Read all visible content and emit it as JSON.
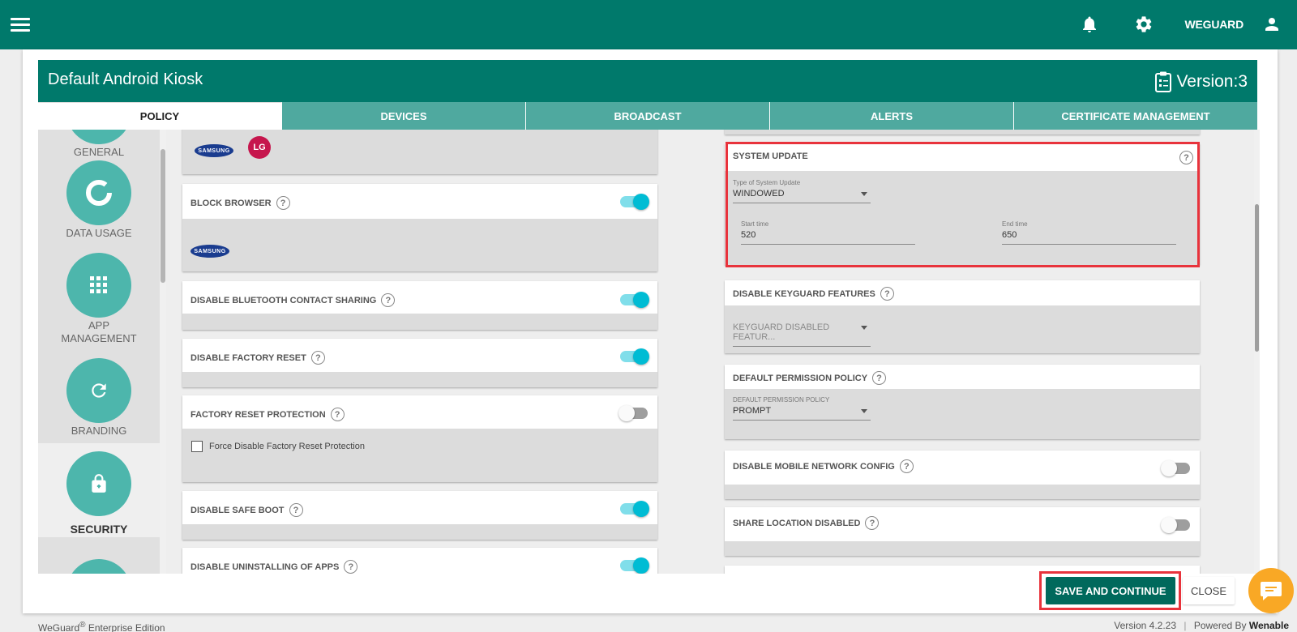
{
  "topbar": {
    "menu_icon": "hamburger-menu-icon",
    "user_name": "WEGUARD",
    "bg_color": "#00796b"
  },
  "policy": {
    "title": "Default Android Kiosk",
    "version": "Version:3"
  },
  "tabs": [
    {
      "label": "POLICY",
      "active": true
    },
    {
      "label": "DEVICES"
    },
    {
      "label": "BROADCAST"
    },
    {
      "label": "ALERTS"
    },
    {
      "label": "CERTIFICATE MANAGEMENT"
    }
  ],
  "sidebar": {
    "items": [
      {
        "label": "GENERAL",
        "icon": "general-icon"
      },
      {
        "label": "DATA USAGE",
        "icon": "donut-chart-icon"
      },
      {
        "label": "APP MANAGEMENT",
        "line1": "APP",
        "line2": "MANAGEMENT",
        "icon": "apps-grid-icon"
      },
      {
        "label": "BRANDING",
        "icon": "refresh-icon"
      },
      {
        "label": "SECURITY",
        "icon": "lock-icon",
        "active": true
      }
    ]
  },
  "left_panels": {
    "logos_panel": {
      "samsung": "SAMSUNG",
      "lg": "LG"
    },
    "block_browser": {
      "title": "BLOCK BROWSER",
      "enabled": true,
      "samsung": "SAMSUNG"
    },
    "bluetooth": {
      "title": "DISABLE BLUETOOTH CONTACT SHARING",
      "enabled": true
    },
    "factory_reset": {
      "title": "DISABLE FACTORY RESET",
      "enabled": true
    },
    "frp": {
      "title": "FACTORY RESET PROTECTION",
      "enabled": false,
      "checkbox_label": "Force Disable Factory Reset Protection",
      "checked": false
    },
    "safe_boot": {
      "title": "DISABLE SAFE BOOT",
      "enabled": true
    },
    "uninstall": {
      "title": "DISABLE UNINSTALLING OF APPS",
      "enabled": true
    }
  },
  "right_panels": {
    "system_update": {
      "title": "SYSTEM UPDATE",
      "type_label": "Type of System Update",
      "type_value": "WINDOWED",
      "start_label": "Start time",
      "start_value": "520",
      "end_label": "End time",
      "end_value": "650"
    },
    "keyguard": {
      "title": "DISABLE KEYGUARD FEATURES",
      "placeholder": "KEYGUARD DISABLED FEATUR..."
    },
    "permission": {
      "title": "DEFAULT PERMISSION POLICY",
      "label": "DEFAULT PERMISSION POLICY",
      "value": "PROMPT"
    },
    "mobile_network": {
      "title": "DISABLE MOBILE NETWORK CONFIG",
      "enabled": false
    },
    "share_location": {
      "title": "SHARE LOCATION DISABLED",
      "enabled": false
    }
  },
  "actions": {
    "save": "SAVE AND CONTINUE",
    "close": "CLOSE"
  },
  "footer": {
    "brand": "WeGuard",
    "reg": "®",
    "edition": " Enterprise Edition",
    "version": "Version 4.2.23",
    "powered": "Powered By",
    "company": "Wenable"
  },
  "colors": {
    "primary": "#00796b",
    "tab": "#4fa99f",
    "toggle_on": "#00bcd4",
    "highlight": "#e8333c",
    "chat": "#f9a825"
  }
}
